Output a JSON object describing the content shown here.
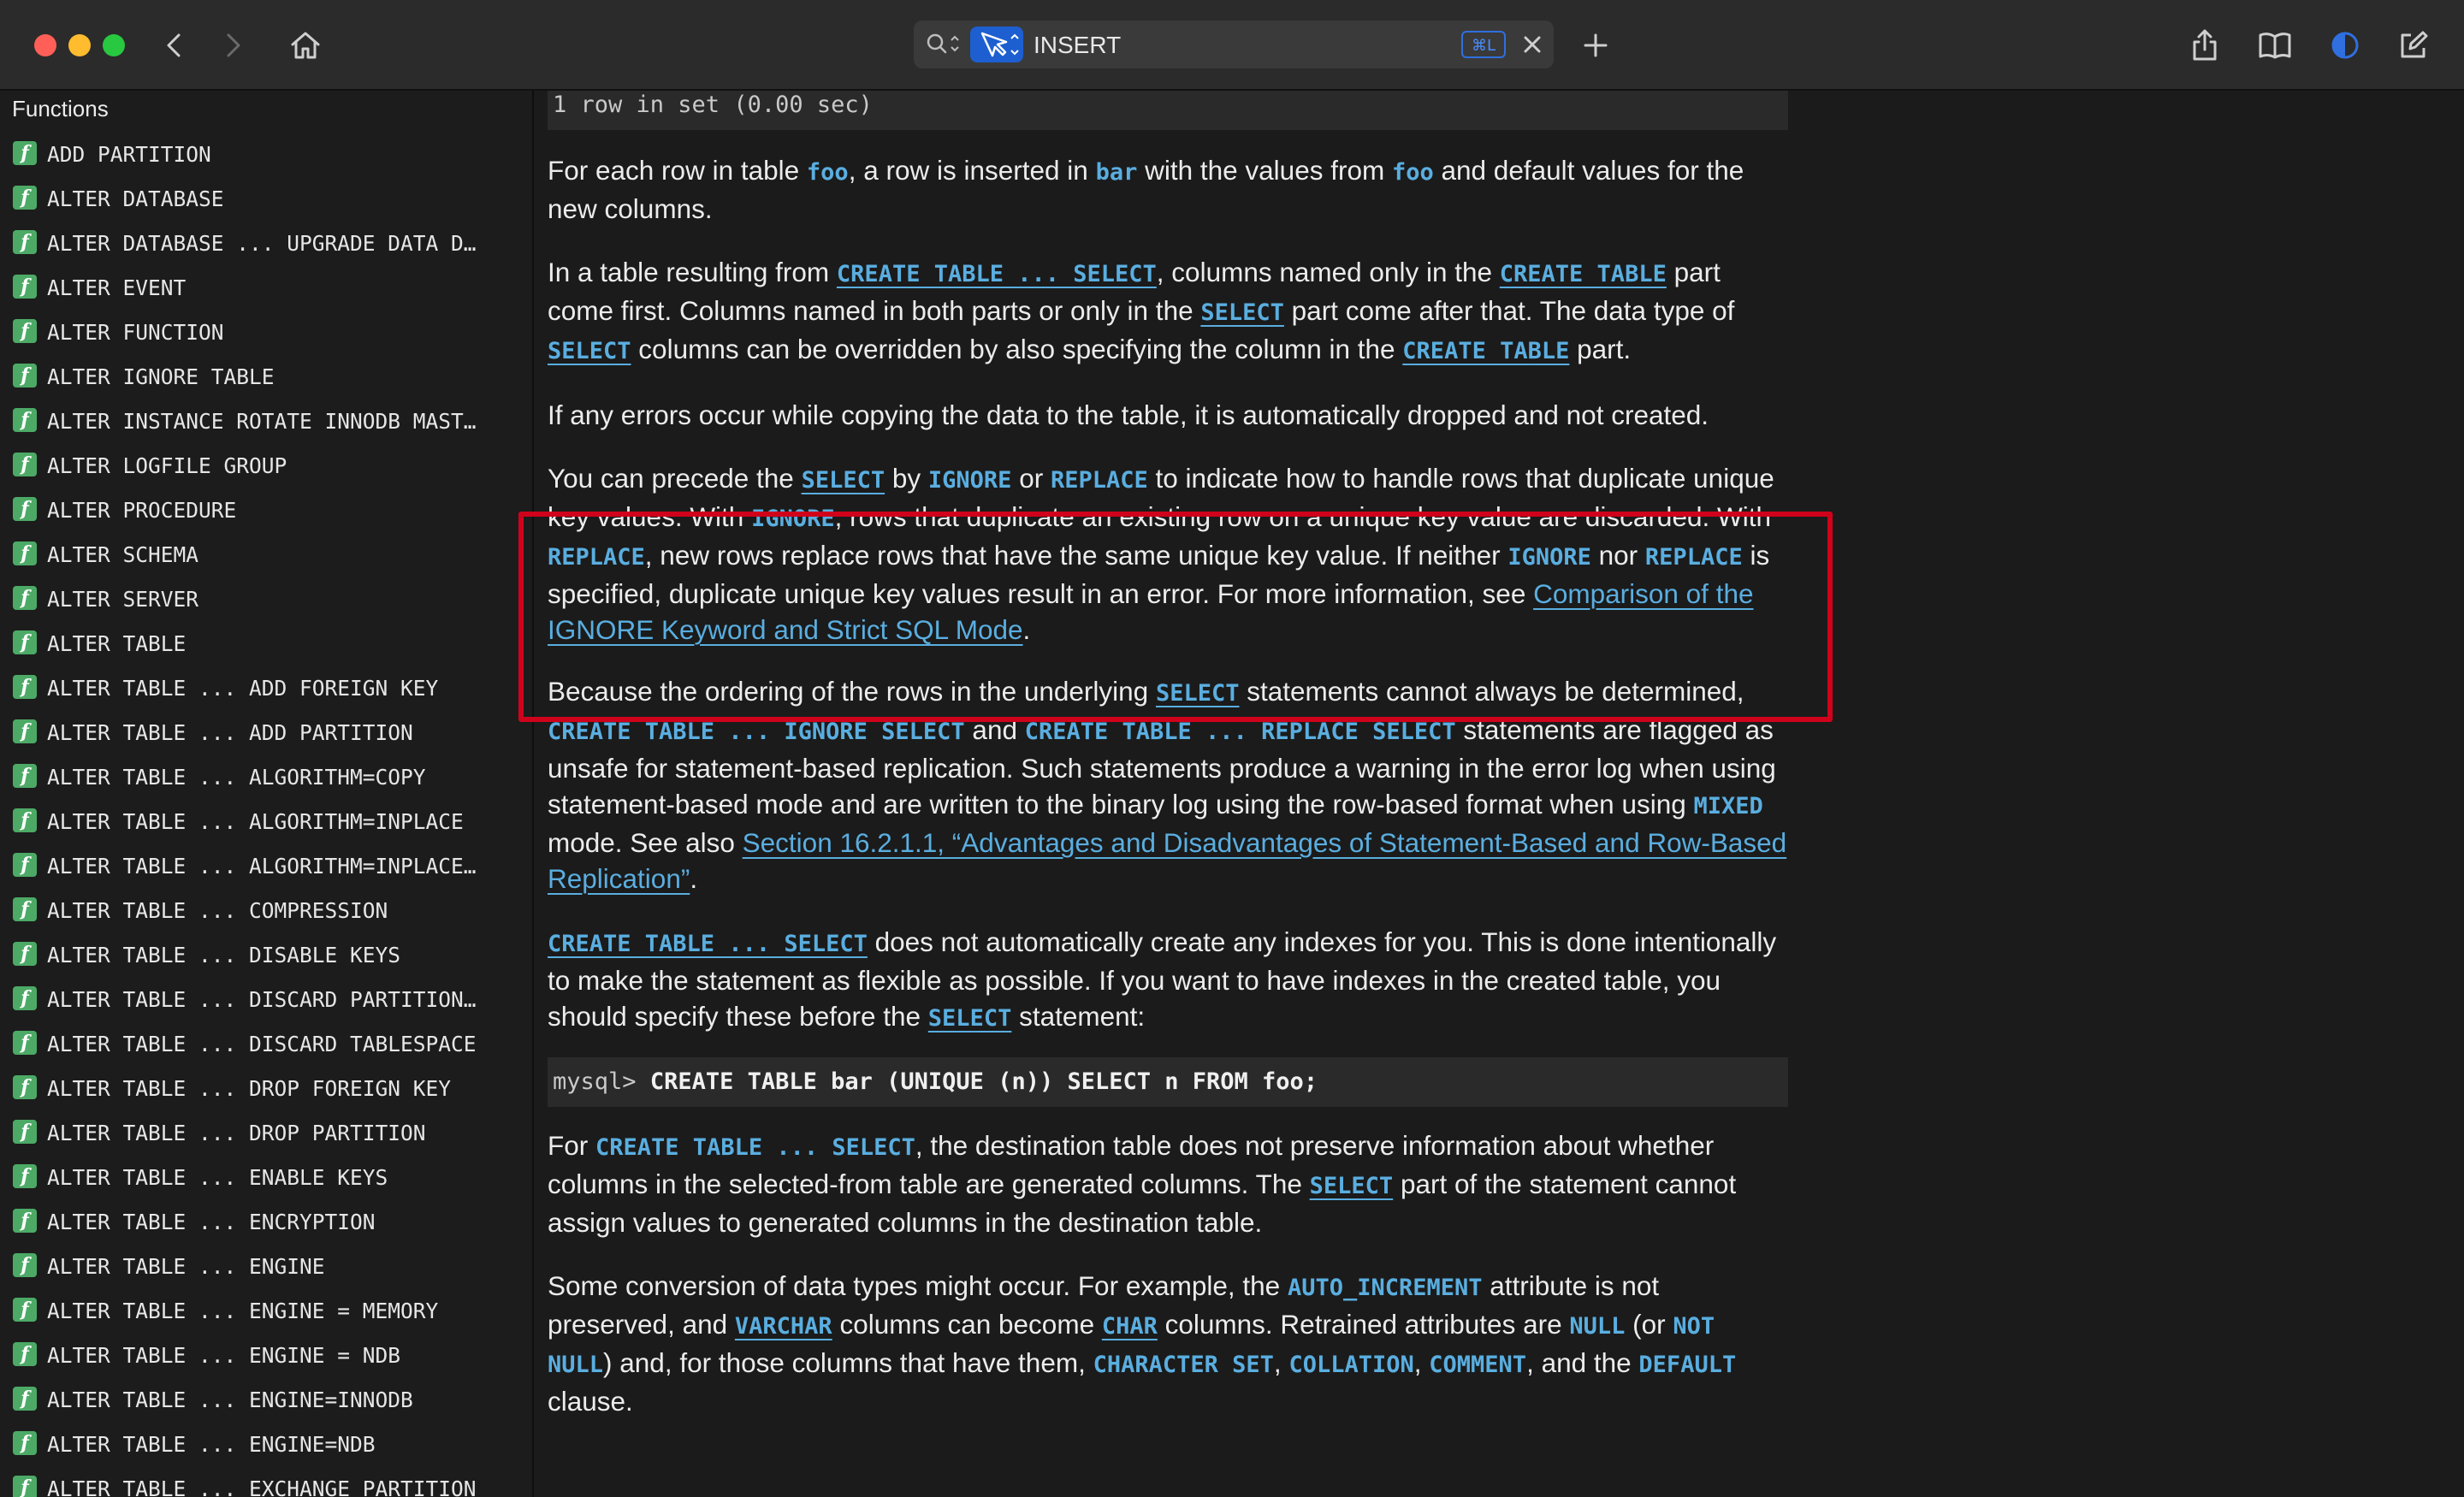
{
  "search": {
    "query": "INSERT",
    "shortcut": "⌘L"
  },
  "sidebar": {
    "title": "Functions",
    "items": [
      "ADD PARTITION",
      "ALTER DATABASE",
      "ALTER DATABASE ... UPGRADE DATA D…",
      "ALTER EVENT",
      "ALTER FUNCTION",
      "ALTER IGNORE TABLE",
      "ALTER INSTANCE ROTATE INNODB MAST…",
      "ALTER LOGFILE GROUP",
      "ALTER PROCEDURE",
      "ALTER SCHEMA",
      "ALTER SERVER",
      "ALTER TABLE",
      "ALTER TABLE ... ADD FOREIGN KEY",
      "ALTER TABLE ... ADD PARTITION",
      "ALTER TABLE ... ALGORITHM=COPY",
      "ALTER TABLE ... ALGORITHM=INPLACE",
      "ALTER TABLE ... ALGORITHM=INPLACE…",
      "ALTER TABLE ... COMPRESSION",
      "ALTER TABLE ... DISABLE KEYS",
      "ALTER TABLE ... DISCARD PARTITION…",
      "ALTER TABLE ... DISCARD TABLESPACE",
      "ALTER TABLE ... DROP FOREIGN KEY",
      "ALTER TABLE ... DROP PARTITION",
      "ALTER TABLE ... ENABLE KEYS",
      "ALTER TABLE ... ENCRYPTION",
      "ALTER TABLE ... ENGINE",
      "ALTER TABLE ... ENGINE = MEMORY",
      "ALTER TABLE ... ENGINE = NDB",
      "ALTER TABLE ... ENGINE=INNODB",
      "ALTER TABLE ... ENGINE=NDB",
      "ALTER TABLE ... EXCHANGE PARTITION"
    ]
  },
  "doc": {
    "result_line": "1 row in set (0.00 sec)",
    "p1": [
      {
        "t": "For each row in table "
      },
      {
        "c": "foo"
      },
      {
        "t": ", a row is inserted in "
      },
      {
        "c": "bar"
      },
      {
        "t": " with the values from "
      },
      {
        "c": "foo"
      },
      {
        "t": " and default values for the new columns."
      }
    ],
    "p2": [
      {
        "t": "In a table resulting from "
      },
      {
        "l": "CREATE TABLE ... SELECT",
        "code": true
      },
      {
        "t": ", columns named only in the "
      },
      {
        "l": "CREATE TABLE",
        "code": true
      },
      {
        "t": " part come first. Columns named in both parts or only in the "
      },
      {
        "l": "SELECT",
        "code": true
      },
      {
        "t": " part come after that. The data type of "
      },
      {
        "l": "SELECT",
        "code": true
      },
      {
        "t": " columns can be overridden by also specifying the column in the "
      },
      {
        "l": "CREATE TABLE",
        "code": true
      },
      {
        "t": " part."
      }
    ],
    "p3": [
      {
        "t": "If any errors occur while copying the data to the table, it is automatically dropped and not created."
      }
    ],
    "p4": [
      {
        "t": "You can precede the "
      },
      {
        "l": "SELECT",
        "code": true
      },
      {
        "t": " by "
      },
      {
        "c": "IGNORE"
      },
      {
        "t": " or "
      },
      {
        "c": "REPLACE"
      },
      {
        "t": " to indicate how to handle rows that duplicate unique key values. With "
      },
      {
        "c": "IGNORE"
      },
      {
        "t": ", rows that duplicate an existing row on a unique key value are discarded. With "
      },
      {
        "c": "REPLACE"
      },
      {
        "t": ", new rows replace rows that have the same unique key value. If neither "
      },
      {
        "c": "IGNORE"
      },
      {
        "t": " nor "
      },
      {
        "c": "REPLACE"
      },
      {
        "t": " is specified, duplicate unique key values result in an error. For more information, see "
      },
      {
        "l": "Comparison of the IGNORE Keyword and Strict SQL Mode"
      },
      {
        "t": "."
      }
    ],
    "p5": [
      {
        "t": "Because the ordering of the rows in the underlying "
      },
      {
        "l": "SELECT",
        "code": true
      },
      {
        "t": " statements cannot always be determined, "
      },
      {
        "c": "CREATE TABLE ... IGNORE SELECT"
      },
      {
        "t": " and "
      },
      {
        "c": "CREATE TABLE ... REPLACE SELECT"
      },
      {
        "t": " statements are flagged as unsafe for statement-based replication. Such statements produce a warning in the error log when using statement-based mode and are written to the binary log using the row-based format when using "
      },
      {
        "c": "MIXED"
      },
      {
        "t": " mode. See also "
      },
      {
        "l": "Section 16.2.1.1, “Advantages and Disadvantages of Statement-Based and Row-Based Replication”"
      },
      {
        "t": "."
      }
    ],
    "p6": [
      {
        "l": "CREATE TABLE ... SELECT",
        "code": true
      },
      {
        "t": " does not automatically create any indexes for you. This is done intentionally to make the statement as flexible as possible. If you want to have indexes in the created table, you should specify these before the "
      },
      {
        "l": "SELECT",
        "code": true
      },
      {
        "t": " statement:"
      }
    ],
    "code_prompt": "mysql>",
    "code_stmt": "CREATE TABLE bar (UNIQUE (n)) SELECT n FROM foo;",
    "p7": [
      {
        "t": "For "
      },
      {
        "c": "CREATE TABLE ... SELECT"
      },
      {
        "t": ", the destination table does not preserve information about whether columns in the selected-from table are generated columns. The "
      },
      {
        "l": "SELECT",
        "code": true
      },
      {
        "t": " part of the statement cannot assign values to generated columns in the destination table."
      }
    ],
    "p8": [
      {
        "t": "Some conversion of data types might occur. For example, the "
      },
      {
        "c": "AUTO_INCREMENT"
      },
      {
        "t": " attribute is not preserved, and "
      },
      {
        "l": "VARCHAR",
        "code": true
      },
      {
        "t": " columns can become "
      },
      {
        "l": "CHAR",
        "code": true
      },
      {
        "t": " columns. Retrained attributes are "
      },
      {
        "c": "NULL"
      },
      {
        "t": " (or "
      },
      {
        "c": "NOT NULL"
      },
      {
        "t": ") and, for those columns that have them, "
      },
      {
        "c": "CHARACTER SET"
      },
      {
        "t": ", "
      },
      {
        "c": "COLLATION"
      },
      {
        "t": ", "
      },
      {
        "c": "COMMENT"
      },
      {
        "t": ", and the "
      },
      {
        "c": "DEFAULT"
      },
      {
        "t": " clause."
      }
    ]
  },
  "colors": {
    "highlight_border": "#d0021b",
    "link": "#5aaee0",
    "accent": "#1d5fd0"
  }
}
